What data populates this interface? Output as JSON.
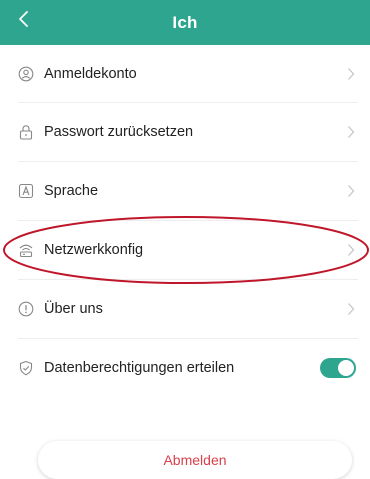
{
  "header": {
    "title": "Ich",
    "back_icon": "chevron-left-icon",
    "background": "#2ea58f"
  },
  "menu": {
    "items": [
      {
        "label": "Anmeldekonto",
        "icon": "user-circle-icon"
      },
      {
        "label": "Passwort zurücksetzen",
        "icon": "lock-icon"
      },
      {
        "label": "Sprache",
        "icon": "language-icon"
      },
      {
        "label": "Netzwerkkonfig",
        "icon": "network-icon"
      },
      {
        "label": "Über uns",
        "icon": "info-icon"
      }
    ]
  },
  "permissions": {
    "label": "Datenberechtigungen erteilen",
    "icon": "shield-check-icon",
    "enabled": true
  },
  "logout": {
    "label": "Abmelden",
    "color": "#d8404a"
  },
  "annotation": {
    "color": "#c0162a"
  }
}
